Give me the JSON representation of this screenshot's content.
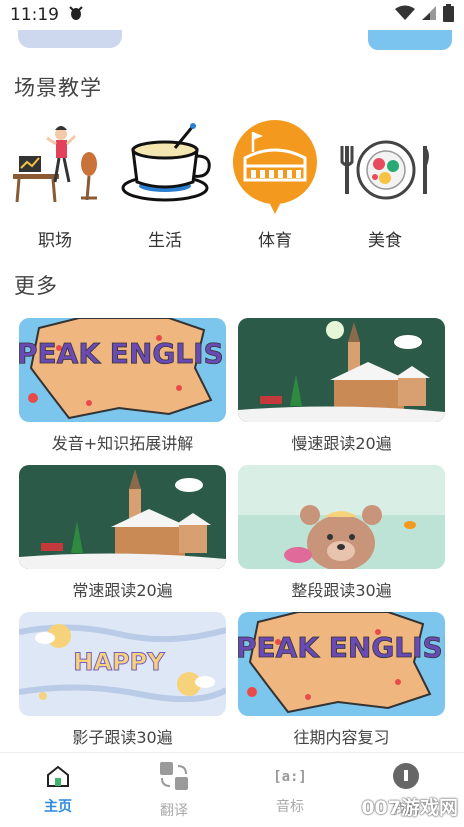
{
  "status": {
    "time": "11:19"
  },
  "sections": {
    "scenes_title": "场景教学",
    "more_title": "更多"
  },
  "scenes": [
    {
      "label": "职场",
      "icon": "office-worker-icon"
    },
    {
      "label": "生活",
      "icon": "coffee-cup-icon"
    },
    {
      "label": "体育",
      "icon": "stadium-icon"
    },
    {
      "label": "美食",
      "icon": "dining-plate-icon"
    }
  ],
  "courses": [
    {
      "label": "发音+知识拓展讲解",
      "thumb_text": "SPEAK ENGLISH"
    },
    {
      "label": "慢速跟读20遍"
    },
    {
      "label": "常速跟读20遍"
    },
    {
      "label": "整段跟读30遍"
    },
    {
      "label": "影子跟读30遍",
      "thumb_text": "HAPPY"
    },
    {
      "label": "往期内容复习",
      "thumb_text": "SPEAK ENGLISH"
    }
  ],
  "nav": [
    {
      "label": "主页",
      "icon": "home-icon",
      "active": true
    },
    {
      "label": "翻译",
      "icon": "translate-icon"
    },
    {
      "label": "音标",
      "icon": "phonetic-icon"
    },
    {
      "label": "我的",
      "icon": "profile-icon"
    }
  ],
  "watermark": "007游戏网",
  "colors": {
    "accent": "#2a8be0",
    "stadium_orange": "#f39a1e"
  }
}
